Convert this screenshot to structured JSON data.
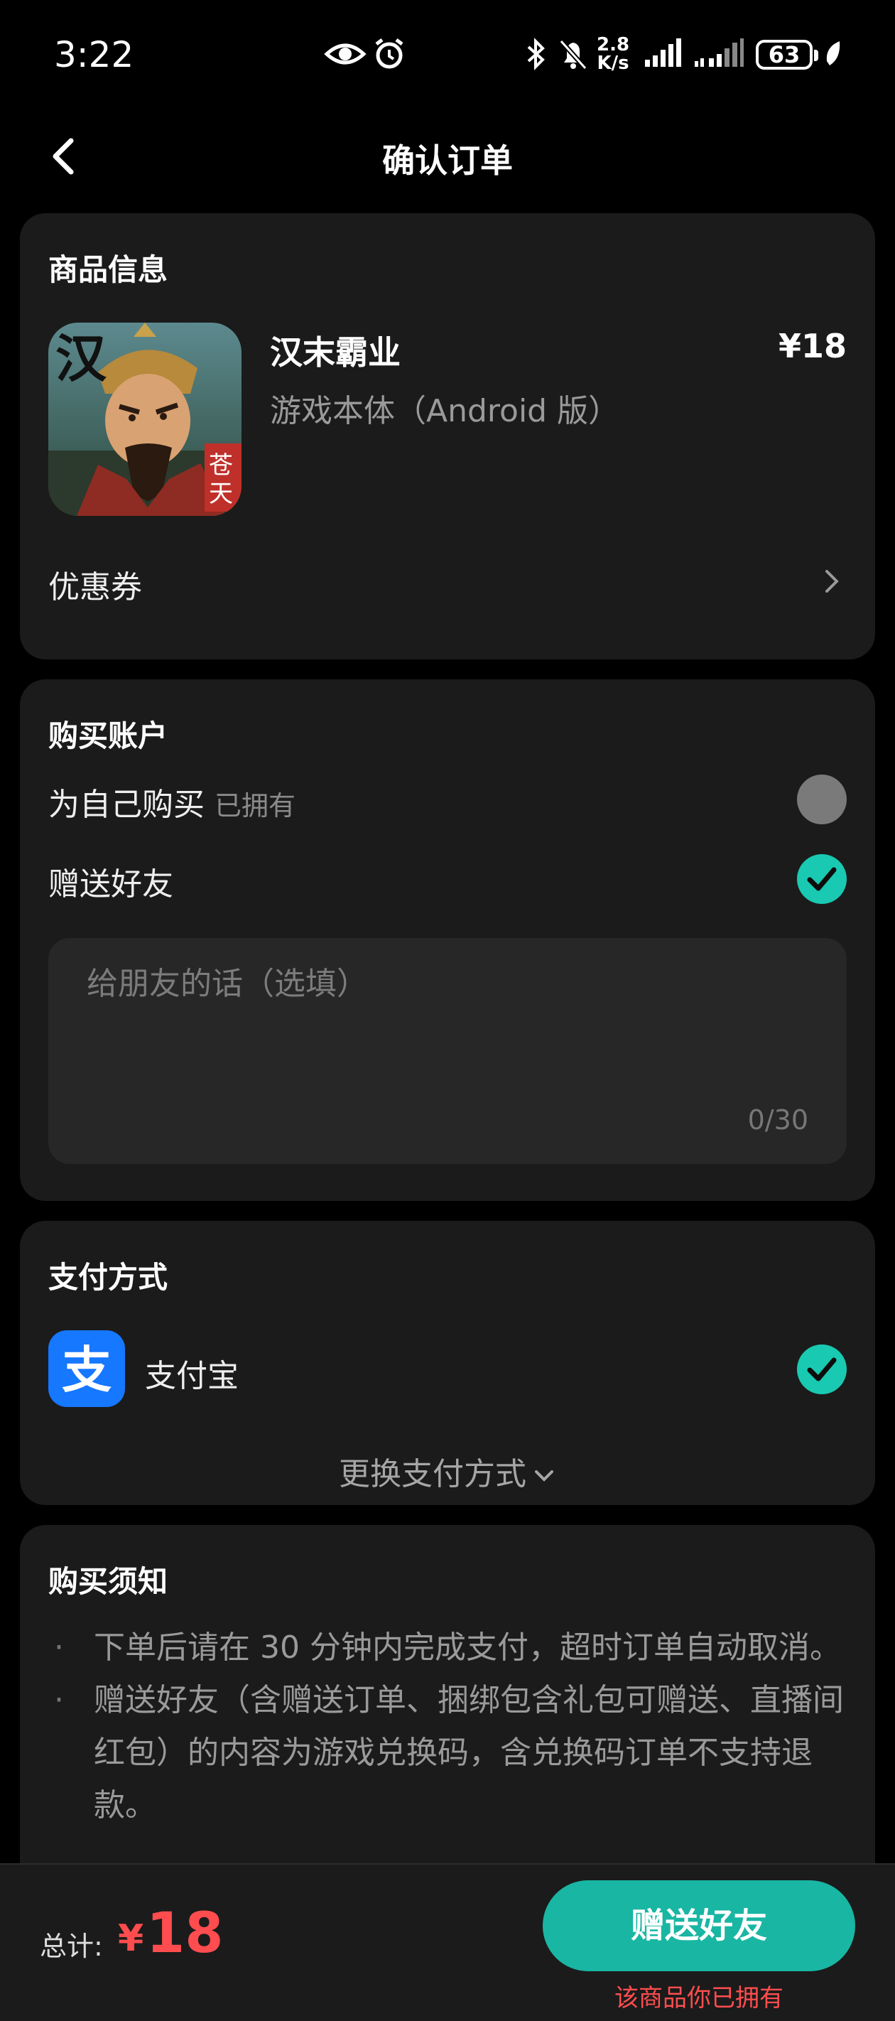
{
  "status_bar": {
    "time": "3:22",
    "net_speed_value": "2.8",
    "net_speed_unit": "K/s",
    "battery": "63",
    "icons": [
      "eye-icon",
      "alarm-icon",
      "bluetooth-icon",
      "mute-bell-icon",
      "signal-icon",
      "signal-2-icon",
      "leaf-icon"
    ]
  },
  "header": {
    "title": "确认订单"
  },
  "product": {
    "section_title": "商品信息",
    "name": "汉末霸业",
    "price": "¥18",
    "variant": "游戏本体（Android 版）",
    "coupon_label": "优惠券"
  },
  "account": {
    "section_title": "购买账户",
    "self_label": "为自己购买",
    "self_sub": "已拥有",
    "gift_label": "赠送好友",
    "message_placeholder": "给朋友的话（选填）",
    "message_value": "",
    "char_count": "0/30",
    "selected": "gift"
  },
  "payment": {
    "section_title": "支付方式",
    "method": "支付宝",
    "change_label": "更换支付方式",
    "accent": "#19c9b1"
  },
  "notice": {
    "section_title": "购买须知",
    "items": [
      "下单后请在 30 分钟内完成支付，超时订单自动取消。",
      "赠送好友（含赠送订单、捆绑包含礼包可赠送、直播间红包）的内容为游戏兑换码，含兑换码订单不支持退款。"
    ]
  },
  "bottom": {
    "total_label": "总计:",
    "currency": "¥",
    "total_value": "18",
    "button_label": "赠送好友",
    "owned_note": "该商品你已拥有"
  }
}
